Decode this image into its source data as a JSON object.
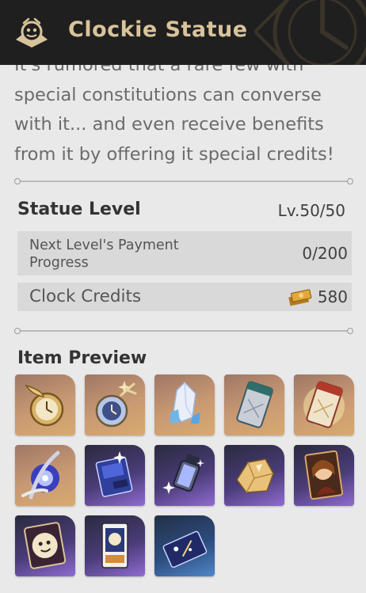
{
  "header": {
    "title": "Clockie Statue",
    "logo_icon": "clockie-emblem-icon"
  },
  "description": {
    "text": "It's rumored that a rare few with special constitutions can converse with it... and even receive benefits from it by offering it special credits!"
  },
  "statue_level": {
    "label": "Statue Level",
    "value": "Lv.50/50"
  },
  "payment_progress": {
    "label": "Next Level's Payment Progress",
    "value": "0/200"
  },
  "clock_credits": {
    "label": "Clock Credits",
    "value": "580",
    "icon": "clock-credits-icon"
  },
  "item_preview": {
    "title": "Item Preview",
    "items": [
      {
        "name": "golden-pocket-watch-icon",
        "rarity": "gold"
      },
      {
        "name": "crystal-pocket-watch-icon",
        "rarity": "gold"
      },
      {
        "name": "crystal-shard-icon",
        "rarity": "gold"
      },
      {
        "name": "silver-ticket-icon",
        "rarity": "gold"
      },
      {
        "name": "golden-ticket-icon",
        "rarity": "gold"
      },
      {
        "name": "cosmic-orb-icon",
        "rarity": "gold"
      },
      {
        "name": "record-book-icon",
        "rarity": "purple"
      },
      {
        "name": "starlight-lantern-icon",
        "rarity": "purple"
      },
      {
        "name": "gold-ore-icon",
        "rarity": "purple"
      },
      {
        "name": "character-portrait-card-icon",
        "rarity": "purple"
      },
      {
        "name": "clockie-portrait-card-icon",
        "rarity": "purple"
      },
      {
        "name": "clockie-postcard-icon",
        "rarity": "purple"
      },
      {
        "name": "night-sky-card-icon",
        "rarity": "blue"
      }
    ]
  },
  "colors": {
    "header_bg": "#1f1f1f",
    "title_gold": "#d9c39a",
    "rarity_gold": "#d8aa6f",
    "rarity_purple": "#8f6bd1",
    "rarity_blue": "#4f86c7"
  }
}
